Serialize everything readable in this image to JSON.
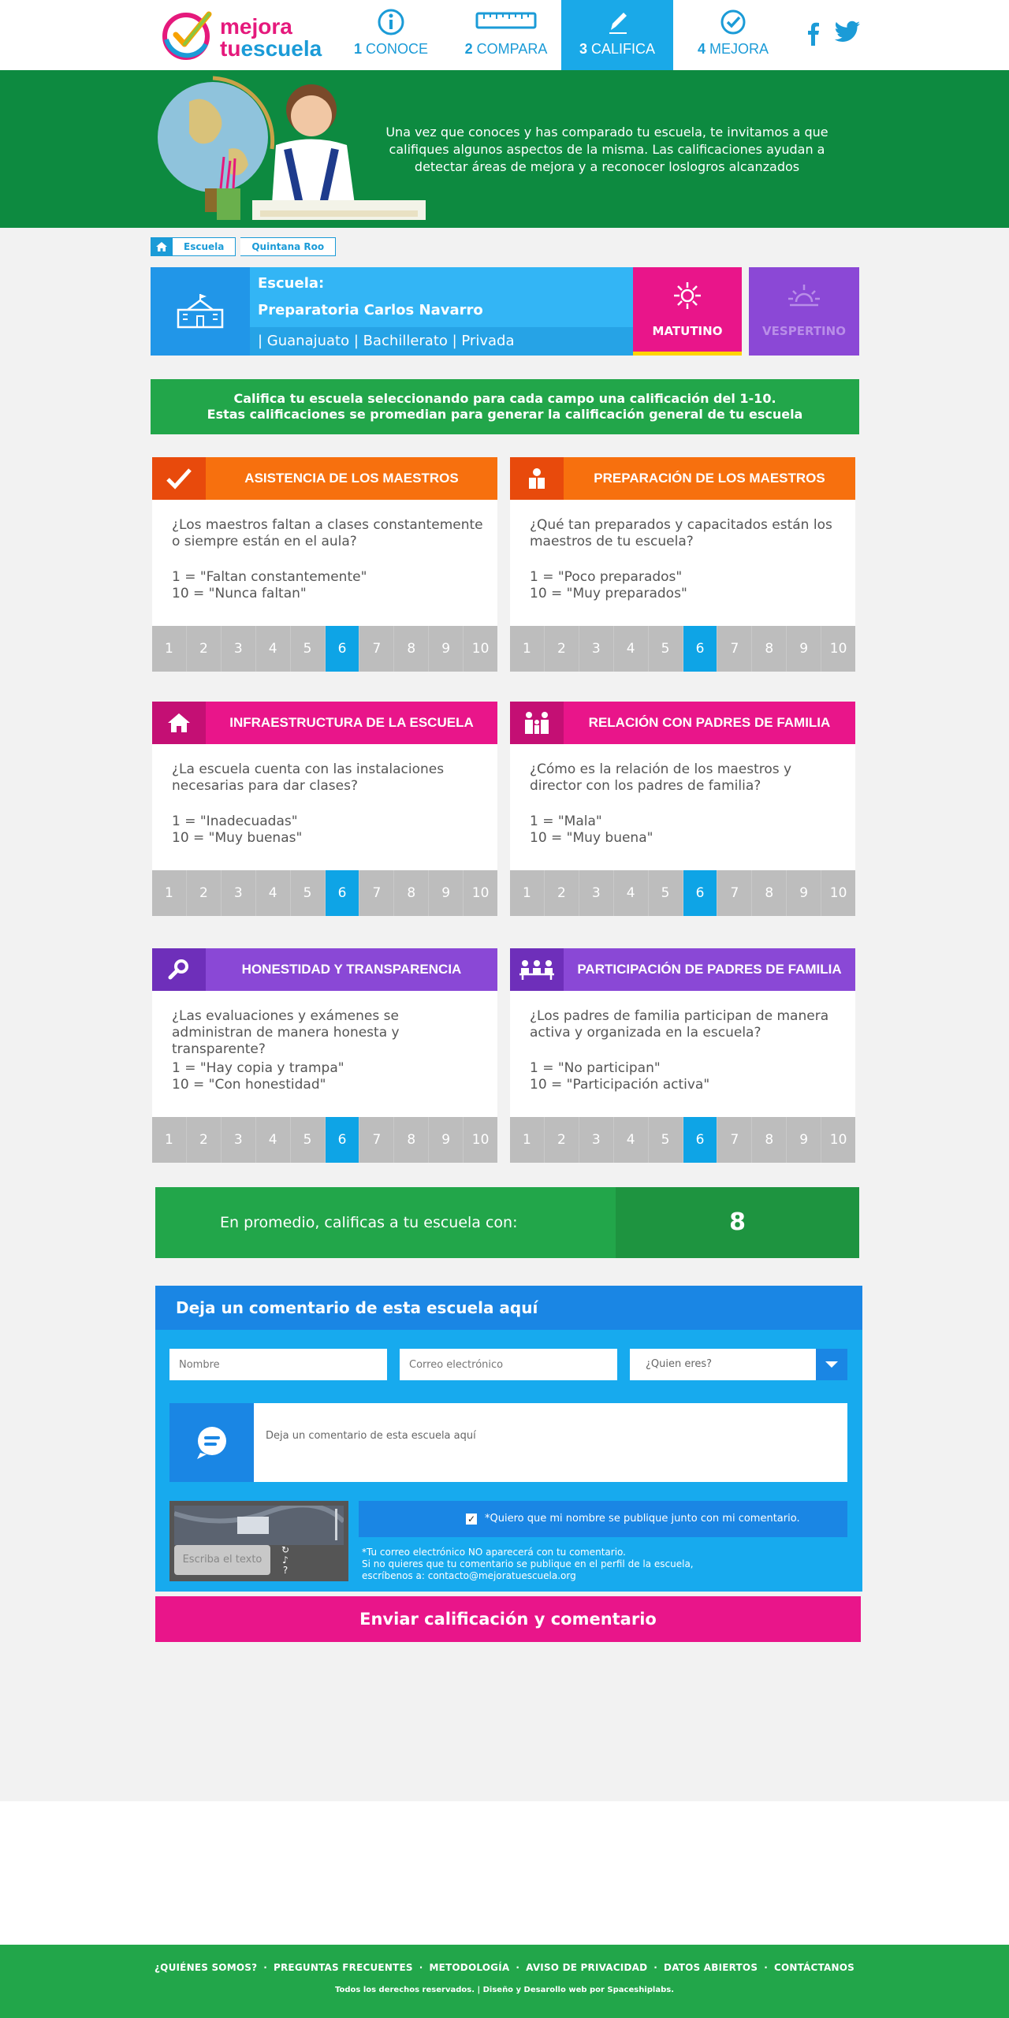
{
  "brand": {
    "line1": "mejora",
    "line2a": "tu",
    "line2b": "escuela"
  },
  "steps": [
    {
      "num": "1",
      "label": "CONOCE",
      "icon": "info-icon"
    },
    {
      "num": "2",
      "label": "COMPARA",
      "icon": "ruler-icon"
    },
    {
      "num": "3",
      "label": "CALIFICA",
      "icon": "pencil-icon"
    },
    {
      "num": "4",
      "label": "MEJORA",
      "icon": "check-circle-icon"
    }
  ],
  "hero": {
    "text": "Una vez que conoces y has comparado tu escuela, te invitamos a que califiques algunos aspectos de la misma. Las calificaciones ayudan a detectar áreas de mejora y a reconocer loslogros alcanzados"
  },
  "breadcrumb": [
    "Escuela",
    "Quintana Roo"
  ],
  "school": {
    "label": "Escuela:",
    "name": "Preparatoria Carlos Navarro",
    "details": "| Guanajuato | Bachillerato | Privada"
  },
  "shifts": {
    "morning": "MATUTINO",
    "evening": "VESPERTINO"
  },
  "notice": {
    "line1a": "Califica tu escuela seleccionando para cada campo una calificación del ",
    "line1b": "1-10.",
    "line2": "Estas calificaciones se promedian para generar la calificación general de tu escuela"
  },
  "scale": [
    "1",
    "2",
    "3",
    "4",
    "5",
    "6",
    "7",
    "8",
    "9",
    "10"
  ],
  "selected": 6,
  "cards": [
    {
      "title": "ASISTENCIA DE LOS MAESTROS",
      "question": "¿Los maestros faltan a clases constantemente o siempre están en el aula?",
      "low": "1 = \"Faltan constantemente\"",
      "high": "10 = \"Nunca faltan\""
    },
    {
      "title": "PREPARACIÓN DE LOS MAESTROS",
      "question": "¿Qué tan preparados y capacitados están los maestros de tu escuela?",
      "low": "1 = \"Poco preparados\"",
      "high": "10 = \"Muy preparados\""
    },
    {
      "title": "INFRAESTRUCTURA DE LA ESCUELA",
      "question": "¿La escuela cuenta con las instalaciones necesarias para dar clases?",
      "low": "1 = \"Inadecuadas\"",
      "high": "10 = \"Muy buenas\""
    },
    {
      "title": "RELACIÓN CON PADRES DE FAMILIA",
      "question": "¿Cómo es la relación de los maestros y director con los padres de familia?",
      "low": "1 = \"Mala\"",
      "high": "10 = \"Muy buena\""
    },
    {
      "title": "HONESTIDAD Y TRANSPARENCIA",
      "question": "¿Las evaluaciones y exámenes se administran de manera honesta y transparente?",
      "low": "1 = \"Hay copia y trampa\"",
      "high": "10 = \"Con honestidad\""
    },
    {
      "title": "PARTICIPACIÓN DE PADRES DE FAMILIA",
      "question": "¿Los padres de familia participan de manera activa y organizada en la escuela?",
      "low": "1 = \"No participan\"",
      "high": "10 = \"Participación activa\""
    }
  ],
  "average": {
    "label": "En promedio, calificas a tu escuela con:",
    "value": "8"
  },
  "comment": {
    "title": "Deja un comentario de esta escuela aquí",
    "name_placeholder": "Nombre",
    "email_placeholder": "Correo electrónico",
    "who_placeholder": "¿Quien eres?",
    "comment_placeholder": "Deja un comentario de esta escuela aquí",
    "captcha_placeholder": "Escriba el texto",
    "publish_label": "*Quiero que mi nombre se publique junto con mi comentario.",
    "note1": "*Tu correo electrónico NO aparecerá con tu comentario.",
    "note2": "Si no quieres que tu comentario se publique en el perfil de la escuela,",
    "note3": "escríbenos a: contacto@mejoratuescuela.org",
    "submit": "Enviar calificación y comentario"
  },
  "footer": {
    "links": [
      "¿QUIÉNES SOMOS?",
      "PREGUNTAS FRECUENTES",
      "METODOLOGÍA",
      "AVISO DE PRIVACIDAD",
      "DATOS ABIERTOS",
      "CONTÁCTANOS"
    ],
    "copyright": "Todos los derechos reservados. | Diseño y Desarollo web por Spaceshiplabs."
  },
  "colors": {
    "blue": "#1b9bd7",
    "pink": "#e9158a",
    "green": "#22a64a",
    "orange": "#f7700e",
    "purple": "#8a48d6"
  }
}
